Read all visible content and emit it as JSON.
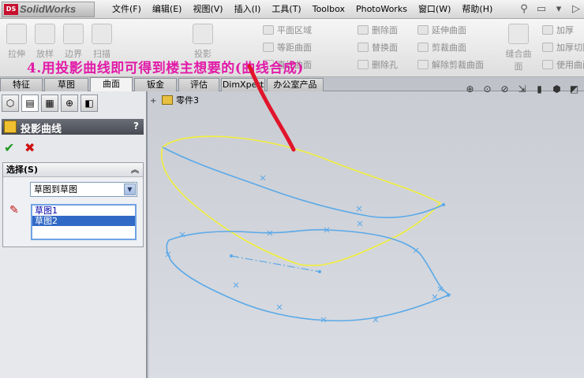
{
  "app": {
    "name": "SolidWorks",
    "logo_mark": "DS"
  },
  "menu": [
    "文件(F)",
    "编辑(E)",
    "视图(V)",
    "插入(I)",
    "工具(T)",
    "Toolbox",
    "PhotoWorks",
    "窗口(W)",
    "帮助(H)"
  ],
  "ribbon": {
    "big_tools": [
      "拉伸",
      "放样",
      "边界",
      "扫描",
      "投影",
      "缝合曲面"
    ],
    "small_col1": [
      "平面区域",
      "等距曲面",
      "直纹曲面"
    ],
    "small_col2": [
      "删除面",
      "替换面",
      "删除孔"
    ],
    "small_col3": [
      "延伸曲面",
      "剪裁曲面",
      "解除剪裁曲面"
    ],
    "small_col4": [
      "加厚",
      "加厚切除",
      "使用曲面"
    ],
    "annotation": "4.用投影曲线即可得到楼主想要的(曲线合成)"
  },
  "tabs": [
    "特征",
    "草图",
    "曲面",
    "钣金",
    "评估",
    "DimXpert",
    "办公室产品"
  ],
  "active_tab": "曲面",
  "property_manager": {
    "title": "投影曲线",
    "help": "?",
    "ok_glyph": "✔",
    "cancel_glyph": "✖",
    "group_title": "选择(S)",
    "mode_value": "草图到草图",
    "sketches": [
      "草图1",
      "草图2"
    ],
    "selected_sketch": "草图2"
  },
  "tree": {
    "root": "零件3"
  },
  "icons": {
    "ok": "check-icon",
    "cancel": "close-icon",
    "sketch_select": "pencil-icon",
    "view_tools": [
      "zoom-fit-icon",
      "zoom-area-icon",
      "zoom-previous-icon",
      "section-view-icon",
      "view-orientation-icon",
      "display-style-icon",
      "hide-show-icon"
    ]
  },
  "colors": {
    "annotation": "#e21aa8",
    "sketch_curve": "#5aa9e8",
    "projected_curve": "#f2ef3a",
    "pen_stroke": "#e0152c"
  }
}
